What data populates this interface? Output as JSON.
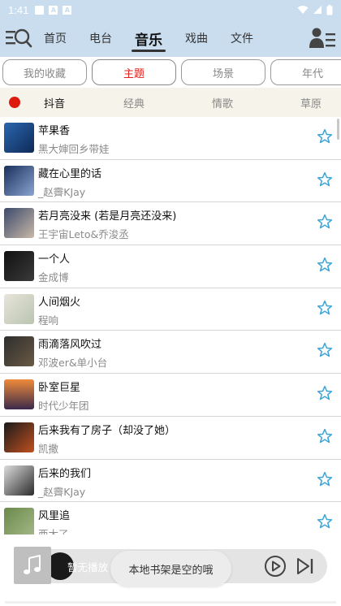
{
  "status_bar": {
    "time": "1:41"
  },
  "header": {
    "tabs": [
      {
        "label": "首页"
      },
      {
        "label": "电台"
      },
      {
        "label": "音乐"
      },
      {
        "label": "戏曲"
      },
      {
        "label": "文件"
      }
    ],
    "active_tab": "音乐"
  },
  "chips": [
    {
      "label": "我的收藏"
    },
    {
      "label": "主题"
    },
    {
      "label": "场景"
    },
    {
      "label": "年代"
    }
  ],
  "active_chip": "主题",
  "subtabs": [
    {
      "label": "抖音"
    },
    {
      "label": "经典"
    },
    {
      "label": "情歌"
    },
    {
      "label": "草原"
    }
  ],
  "active_subtab": "抖音",
  "songs": [
    {
      "title": "苹果香",
      "artist": "黑大婶回乡带娃"
    },
    {
      "title": "藏在心里的话",
      "artist": "_赵霽KJay"
    },
    {
      "title": "若月亮没来 (若是月亮还没来)",
      "artist": "王宇宙Leto&乔浚丞"
    },
    {
      "title": "一个人",
      "artist": "金成博"
    },
    {
      "title": "人间烟火",
      "artist": "程响"
    },
    {
      "title": "雨滴落风吹过",
      "artist": "邓波er&单小台"
    },
    {
      "title": "卧室巨星",
      "artist": "时代少年团"
    },
    {
      "title": "后来我有了房子（却没了她）",
      "artist": "凯撒"
    },
    {
      "title": "后来的我们",
      "artist": "_赵霽KJay"
    },
    {
      "title": "风里追",
      "artist": "西大了"
    }
  ],
  "player": {
    "status": "暂无播放"
  },
  "toast": {
    "message": "本地书架是空的哦"
  },
  "colors": {
    "header_bg": "#c9ddef",
    "accent_red": "#dd1c0f",
    "star_blue": "#3aa4d8",
    "subtab_bg": "#f6f4ea"
  }
}
